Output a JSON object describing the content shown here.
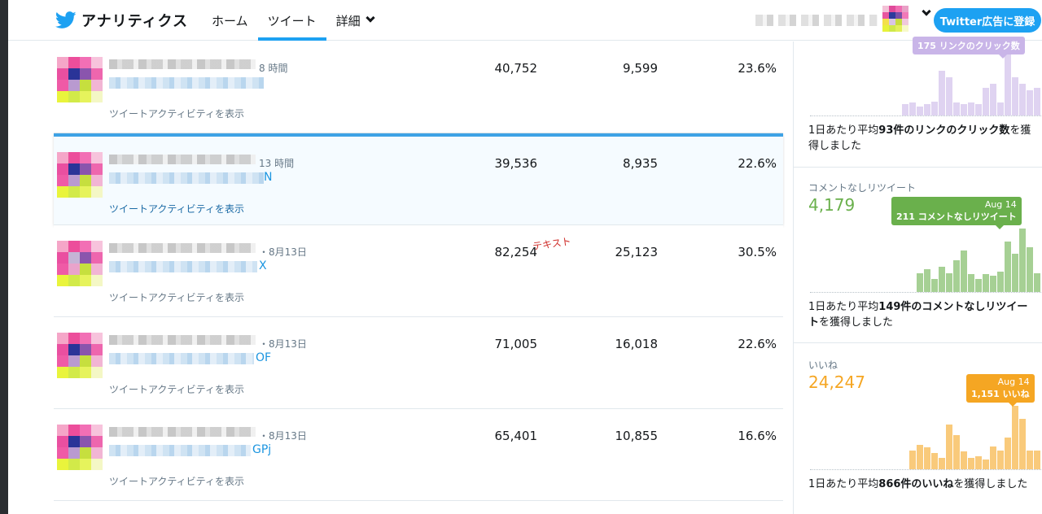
{
  "header": {
    "brand_title": "アナリティクス",
    "nav": [
      {
        "label": "ホーム",
        "active": false
      },
      {
        "label": "ツイート",
        "active": true
      },
      {
        "label": "詳細",
        "active": false
      }
    ],
    "ads_button": "Twitter広告に登録"
  },
  "tweets": [
    {
      "time": "8 時間",
      "link_end": "",
      "activity": "ツイートアクティビティを表示",
      "impressions": "40,752",
      "engagements": "9,599",
      "rate": "23.6%"
    },
    {
      "time": "13 時間",
      "link_end": "N",
      "activity": "ツイートアクティビティを表示",
      "impressions": "39,536",
      "engagements": "8,935",
      "rate": "22.6%",
      "selected": true
    },
    {
      "time": "・8月13日",
      "link_end": "X",
      "activity": "ツイートアクティビティを表示",
      "impressions": "82,254",
      "engagements": "25,123",
      "rate": "30.5%",
      "scribble": "テキスト"
    },
    {
      "time": "・8月13日",
      "link_end": "OF",
      "activity": "ツイートアクティビティを表示",
      "impressions": "71,005",
      "engagements": "16,018",
      "rate": "22.6%"
    },
    {
      "time": "・8月13日",
      "link_end": "GPj",
      "activity": "ツイートアクティビティを表示",
      "impressions": "65,401",
      "engagements": "10,855",
      "rate": "16.6%"
    }
  ],
  "cards": [
    {
      "label": "",
      "value": "",
      "color": "#c9b5e8",
      "tip_date": "",
      "tip_text": "175 リンクのクリック数",
      "desc_pre": "1日あたり平均",
      "desc_bold1": "93件のリンクのクリック数",
      "desc_post": "を獲得しました",
      "bars": [
        0,
        0,
        0,
        0,
        0,
        0,
        0,
        0,
        0,
        0,
        0,
        0,
        0,
        0,
        18,
        20,
        14,
        18,
        22,
        70,
        60,
        20,
        18,
        20,
        18,
        44,
        50,
        20,
        100,
        60,
        50,
        40,
        44
      ]
    },
    {
      "label": "コメントなしリツイート",
      "value": "4,179",
      "color": "#6ab04c",
      "tip_date": "Aug 14",
      "tip_text": "211 コメントなしリツイート",
      "desc_pre": "1日あたり平均",
      "desc_bold1": "149件のコメントなしリツイート",
      "desc_post": "を獲得しました",
      "bars": [
        0,
        0,
        0,
        0,
        0,
        0,
        0,
        0,
        0,
        0,
        0,
        0,
        0,
        0,
        30,
        36,
        20,
        40,
        30,
        50,
        66,
        28,
        20,
        28,
        26,
        32,
        80,
        60,
        100,
        70,
        30
      ]
    },
    {
      "label": "いいね",
      "value": "24,247",
      "color": "#f5a623",
      "tip_date": "Aug 14",
      "tip_text": "1,151 いいね",
      "desc_pre": "1日あたり平均",
      "desc_bold1": "866件のいいね",
      "desc_post": "を獲得しました",
      "bars": [
        0,
        0,
        0,
        0,
        0,
        0,
        0,
        0,
        0,
        0,
        0,
        0,
        0,
        0,
        30,
        38,
        34,
        26,
        18,
        70,
        54,
        28,
        18,
        20,
        16,
        36,
        30,
        50,
        100,
        80,
        30,
        30
      ]
    }
  ]
}
